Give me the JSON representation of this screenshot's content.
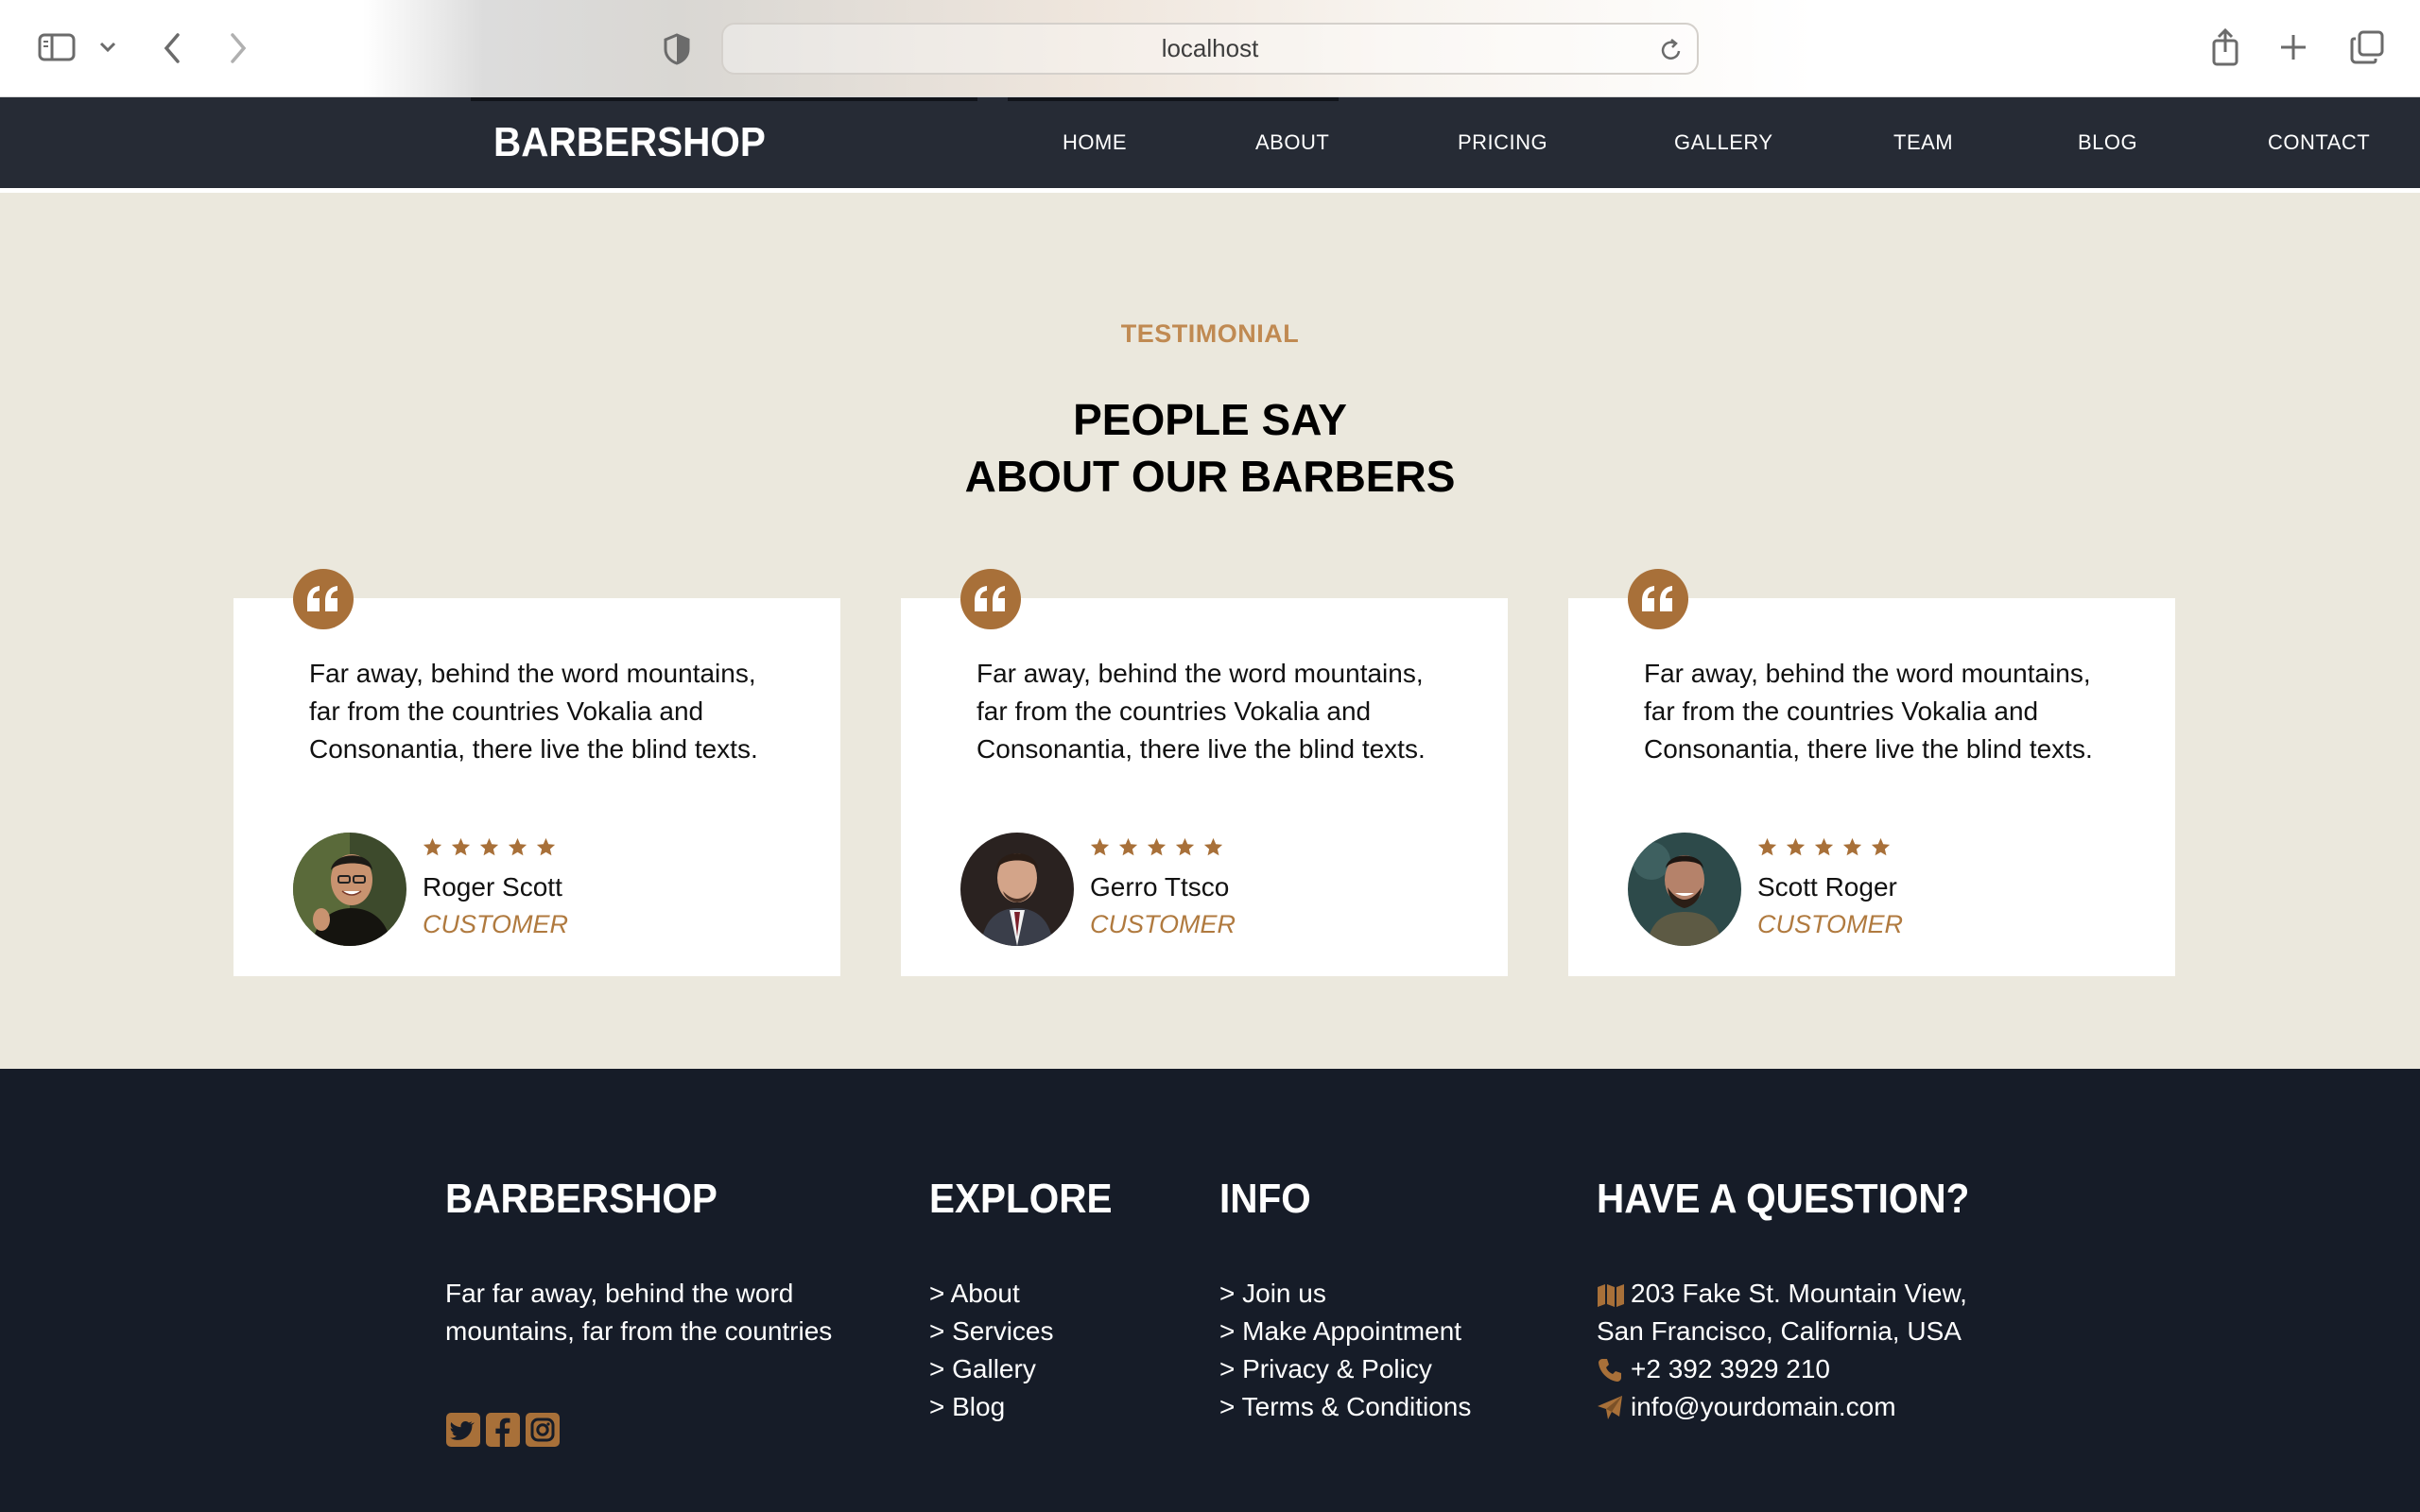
{
  "browser": {
    "url": "localhost",
    "icons": [
      "sidebar-icon",
      "chevron-down-icon",
      "back-icon",
      "forward-icon",
      "privacy-shield-icon",
      "reload-icon",
      "share-icon",
      "new-tab-icon",
      "tabs-overview-icon"
    ]
  },
  "site": {
    "brand": "BARBERSHOP",
    "nav": [
      "HOME",
      "ABOUT",
      "PRICING",
      "GALLERY",
      "TEAM",
      "BLOG",
      "CONTACT"
    ]
  },
  "testimonial": {
    "eyebrow": "TESTIMONIAL",
    "heading_line1": "PEOPLE SAY",
    "heading_line2": "ABOUT OUR BARBERS",
    "cards": [
      {
        "text": "Far away, behind the word mountains, far from the countries Vokalia and Consonantia, there live the blind texts.",
        "rating": 5,
        "name": "Roger Scott",
        "role": "CUSTOMER"
      },
      {
        "text": "Far away, behind the word mountains, far from the countries Vokalia and Consonantia, there live the blind texts.",
        "rating": 5,
        "name": "Gerro Ttsco",
        "role": "CUSTOMER"
      },
      {
        "text": "Far away, behind the word mountains, far from the countries Vokalia and Consonantia, there live the blind texts.",
        "rating": 5,
        "name": "Scott Roger",
        "role": "CUSTOMER"
      }
    ]
  },
  "footer": {
    "brand": "BARBERSHOP",
    "about_text": "Far far away, behind the word mountains, far from the countries",
    "social_icons": [
      "twitter-icon",
      "facebook-icon",
      "instagram-icon"
    ],
    "explore": {
      "title": "EXPLORE",
      "items": [
        "> About",
        "> Services",
        "> Gallery",
        "> Blog"
      ]
    },
    "info": {
      "title": "INFO",
      "items": [
        "> Join us",
        "> Make Appointment",
        "> Privacy & Policy",
        "> Terms & Conditions"
      ]
    },
    "question": {
      "title": "HAVE A QUESTION?",
      "address_line1": "203 Fake St. Mountain View,",
      "address_line2": "San Francisco, California, USA",
      "phone": "+2 392 3929 210",
      "email": "info@yourdomain.com"
    }
  },
  "colors": {
    "accent": "#a87039",
    "accent_text": "#c08a52",
    "nav_bg": "#262b35",
    "section_bg": "#ebe8dd",
    "footer_bg": "#161c28"
  }
}
